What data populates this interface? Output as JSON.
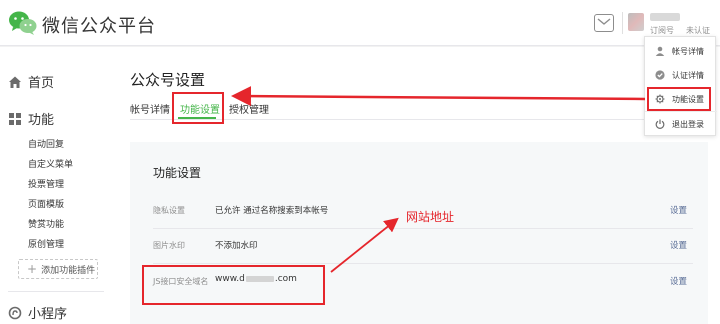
{
  "header": {
    "brand": "微信公众平台",
    "account_type": "订阅号",
    "verify_status": "未认证"
  },
  "account_menu": {
    "items": [
      {
        "label": "帐号详情",
        "icon": "user-icon"
      },
      {
        "label": "认证详情",
        "icon": "check-badge-icon"
      },
      {
        "label": "功能设置",
        "icon": "gear-icon"
      },
      {
        "label": "退出登录",
        "icon": "power-icon"
      }
    ]
  },
  "sidebar": {
    "home": "首页",
    "functions": "功能",
    "function_items": [
      "自动回复",
      "自定义菜单",
      "投票管理",
      "页面模版",
      "赞赏功能",
      "原创管理"
    ],
    "add_plugin": "添加功能插件",
    "mini_program": "小程序"
  },
  "main": {
    "page_title": "公众号设置",
    "tabs": [
      {
        "label": "帐号详情",
        "active": false
      },
      {
        "label": "功能设置",
        "active": true
      },
      {
        "label": "授权管理",
        "active": false
      }
    ],
    "section_title": "功能设置",
    "rows": [
      {
        "label": "隐私设置",
        "value": "已允许 通过名称搜索到本帐号",
        "action": "设置"
      },
      {
        "label": "图片水印",
        "value": "不添加水印",
        "action": "设置"
      },
      {
        "label": "JS接口安全域名",
        "value_prefix": "www.d",
        "value_suffix": ".com",
        "action": "设置"
      }
    ]
  },
  "annotation": {
    "text": "网站地址",
    "color": "#e5262c"
  },
  "colors": {
    "accent_green": "#44b549",
    "link_blue": "#576b95"
  }
}
